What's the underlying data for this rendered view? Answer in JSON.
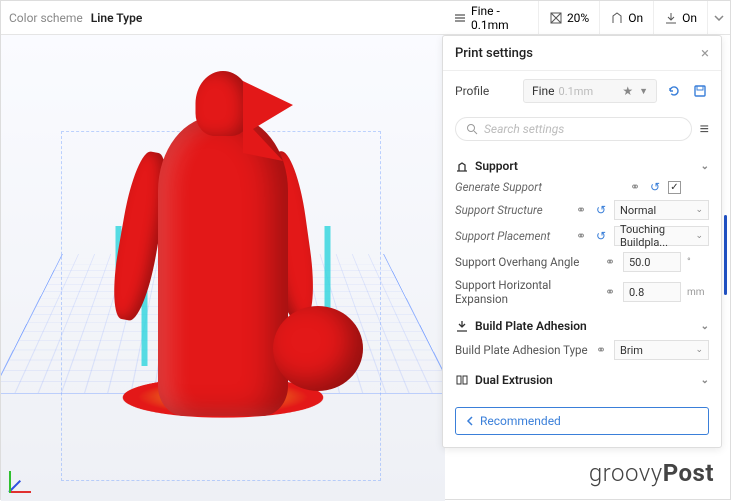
{
  "toolbar": {
    "color_scheme_label": "Color scheme",
    "line_type": "Line Type"
  },
  "right_bar": {
    "quality": "Fine - 0.1mm",
    "infill": "20%",
    "support": "On",
    "adhesion": "On"
  },
  "panel": {
    "title": "Print settings",
    "profile_label": "Profile",
    "profile_name": "Fine",
    "profile_sub": "0.1mm",
    "search_placeholder": "Search settings",
    "recommended": "Recommended"
  },
  "sections": {
    "support": {
      "title": "Support",
      "generate": {
        "label": "Generate Support",
        "checked": true
      },
      "structure": {
        "label": "Support Structure",
        "value": "Normal"
      },
      "placement": {
        "label": "Support Placement",
        "value": "Touching Buildpla..."
      },
      "overhang": {
        "label": "Support Overhang Angle",
        "value": "50.0",
        "unit": "°"
      },
      "horiz_exp": {
        "label": "Support Horizontal Expansion",
        "value": "0.8",
        "unit": "mm"
      }
    },
    "adhesion": {
      "title": "Build Plate Adhesion",
      "type": {
        "label": "Build Plate Adhesion Type",
        "value": "Brim"
      }
    },
    "dual": {
      "title": "Dual Extrusion"
    }
  },
  "watermark": {
    "brand": "groovy",
    "suffix": "Post"
  }
}
